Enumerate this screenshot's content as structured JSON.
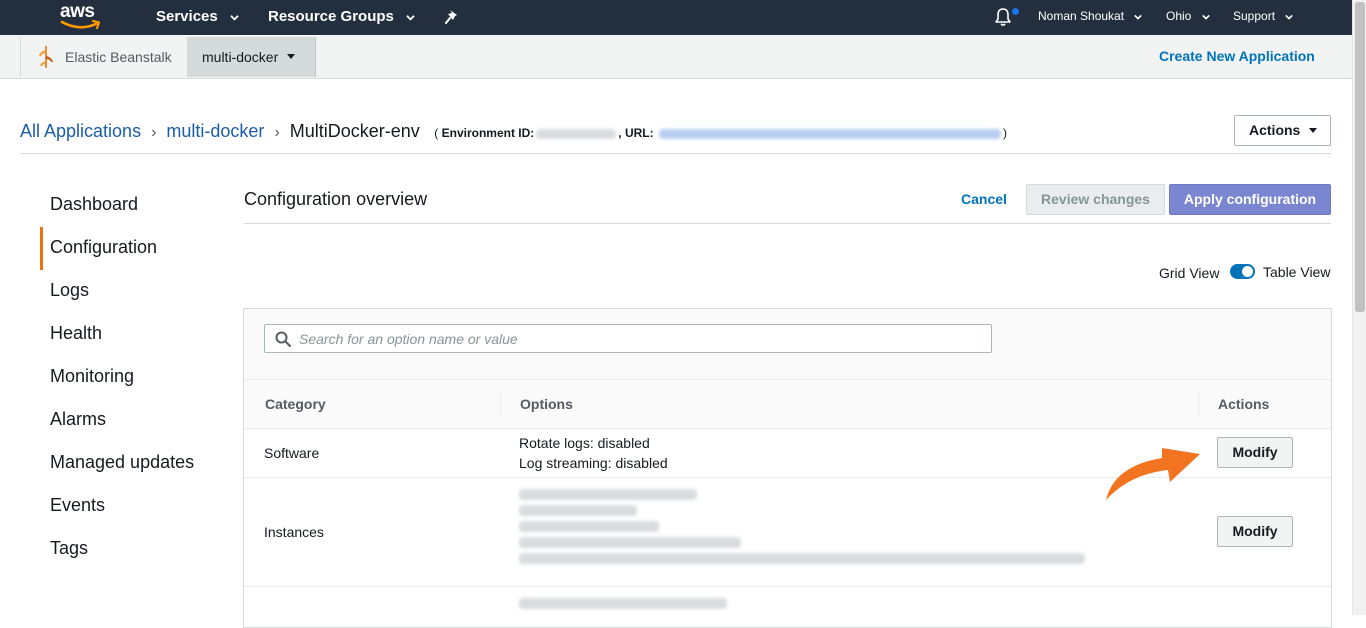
{
  "topnav": {
    "logo_text": "aws",
    "services_label": "Services",
    "resource_groups_label": "Resource Groups",
    "user_label": "Noman Shoukat",
    "region_label": "Ohio",
    "support_label": "Support"
  },
  "subbar": {
    "service_label": "Elastic Beanstalk",
    "app_label": "multi-docker",
    "create_label": "Create New Application"
  },
  "breadcrumb": {
    "all_apps": "All Applications",
    "app": "multi-docker",
    "env": "MultiDocker-env",
    "env_open": "(",
    "env_id_label": "Environment ID:",
    "url_label": ", URL:",
    "env_close": ")"
  },
  "actions_label": "Actions",
  "sidebar": {
    "items": [
      {
        "label": "Dashboard"
      },
      {
        "label": "Configuration"
      },
      {
        "label": "Logs"
      },
      {
        "label": "Health"
      },
      {
        "label": "Monitoring"
      },
      {
        "label": "Alarms"
      },
      {
        "label": "Managed updates"
      },
      {
        "label": "Events"
      },
      {
        "label": "Tags"
      }
    ]
  },
  "config": {
    "title": "Configuration overview",
    "cancel_label": "Cancel",
    "review_label": "Review changes",
    "apply_label": "Apply configuration",
    "grid_view_label": "Grid View",
    "table_view_label": "Table View",
    "search_placeholder": "Search for an option name or value"
  },
  "table": {
    "headers": {
      "category": "Category",
      "options": "Options",
      "actions": "Actions"
    },
    "rows": [
      {
        "category": "Software",
        "options": [
          "Rotate logs: disabled",
          "Log streaming: disabled"
        ],
        "action": "Modify"
      },
      {
        "category": "Instances",
        "options": [],
        "action": "Modify"
      }
    ]
  },
  "colors": {
    "nav_bg": "#232f3e",
    "link": "#0073bb",
    "accent_orange": "#ec7211",
    "apply_bg": "#7b86d1",
    "arrow": "#f27420"
  },
  "icons": [
    "aws-smile-icon",
    "caret-down-icon",
    "pin-icon",
    "bell-icon",
    "elastic-beanstalk-icon",
    "search-icon",
    "curved-arrow-icon"
  ]
}
